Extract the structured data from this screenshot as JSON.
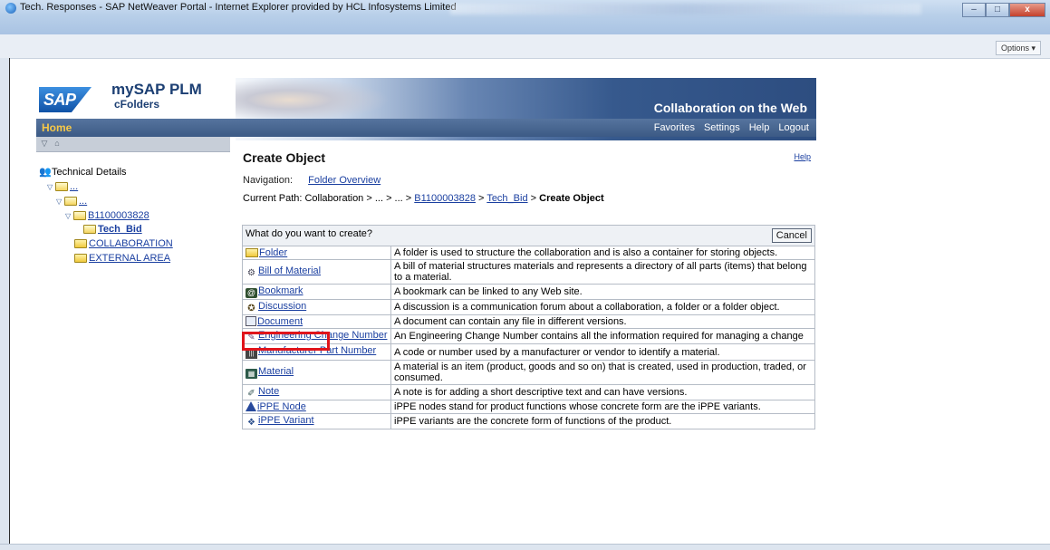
{
  "window": {
    "title": "Tech. Responses - SAP NetWeaver Portal - Internet Explorer provided by HCL Infosystems Limited",
    "options_label": "Options ▾",
    "min_label": "–",
    "max_label": "□",
    "close_label": "x"
  },
  "header": {
    "logo": "SAP",
    "product": "mySAP PLM",
    "sub": "cFolders",
    "slogan": "Collaboration on the Web",
    "home_tab": "Home",
    "links": [
      "Favorites",
      "Settings",
      "Help",
      "Logout"
    ]
  },
  "tree": {
    "root": "Technical Details",
    "collapsed1": "...",
    "collapsed2": "...",
    "folder": "B1100003828",
    "current": "Tech_Bid",
    "collab": "COLLABORATION",
    "external": "EXTERNAL AREA"
  },
  "content": {
    "title": "Create Object",
    "help": "Help",
    "nav_label": "Navigation:",
    "nav_link": "Folder Overview",
    "path_label": "Current Path:",
    "path_collab": "Collaboration",
    "path_sep1": " > ... > ... > ",
    "path_folder": "B1100003828",
    "path_sep2": " > ",
    "path_tech": "Tech_Bid",
    "path_sep3": " > ",
    "path_current": "Create Object",
    "question": "What do you want to create?",
    "cancel": "Cancel"
  },
  "objects": [
    {
      "label": "Folder",
      "icon": "folder-icon",
      "desc": "A folder is used to structure the collaboration and is also a container for storing objects."
    },
    {
      "label": "Bill of Material",
      "icon": "bom-icon",
      "desc": "A bill of material structures materials and represents a directory of all parts (items) that belong to a material."
    },
    {
      "label": "Bookmark",
      "icon": "bookmark-icon",
      "desc": "A bookmark can be linked to any Web site."
    },
    {
      "label": "Discussion",
      "icon": "discussion-icon",
      "desc": "A discussion is a communication forum about a collaboration, a folder or a folder object."
    },
    {
      "label": "Document",
      "icon": "document-icon",
      "desc": "A document can contain any file in different versions."
    },
    {
      "label": "Engineering Change Number",
      "icon": "ecn-icon",
      "desc": "An Engineering Change Number contains all the information required for managing a change"
    },
    {
      "label": "Manufacturer Part Number",
      "icon": "mpn-icon",
      "desc": "A code or number used by a manufacturer or vendor to identify a material."
    },
    {
      "label": "Material",
      "icon": "material-icon",
      "desc": "A material is an item (product, goods and so on) that is created, used in production, traded, or consumed."
    },
    {
      "label": "Note",
      "icon": "note-icon",
      "desc": "A note is for adding a short descriptive text and can have versions."
    },
    {
      "label": "iPPE Node",
      "icon": "ippe-node-icon",
      "desc": "iPPE nodes stand for product functions whose concrete form are the iPPE variants."
    },
    {
      "label": "iPPE Variant",
      "icon": "ippe-variant-icon",
      "desc": "iPPE variants are the concrete form of functions of the product."
    }
  ],
  "colors": {
    "highlight": "#e0141b",
    "link": "#1a3fa0",
    "home_tab": "#f7c948"
  }
}
